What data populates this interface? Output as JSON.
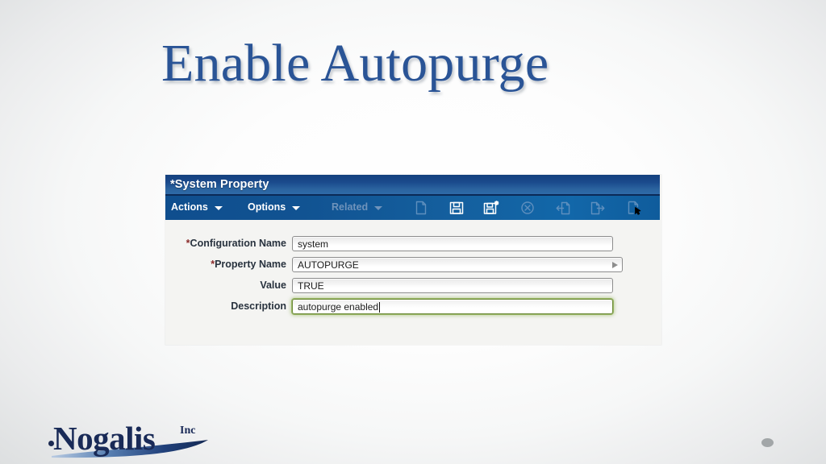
{
  "slide": {
    "title": "Enable Autopurge",
    "title_color": "#2a5496",
    "background_note": "white-center radial gradient to light gray edges"
  },
  "app_window": {
    "title": "*System Property",
    "titlebar_color": "#1a4a8c",
    "toolbar_color": "#115392",
    "menus": [
      {
        "label": "Actions",
        "caret": "chevron-down-icon",
        "enabled": true
      },
      {
        "label": "Options",
        "caret": "chevron-down-icon",
        "enabled": true
      },
      {
        "label": "Related",
        "caret": "chevron-down-icon",
        "enabled": false
      }
    ],
    "toolbar_icons": [
      {
        "name": "new-document-icon",
        "label": "New",
        "enabled": false
      },
      {
        "name": "save-icon",
        "label": "Save",
        "enabled": true
      },
      {
        "name": "save-as-icon",
        "label": "Save As",
        "enabled": true
      },
      {
        "name": "cancel-icon",
        "label": "Cancel",
        "enabled": false
      },
      {
        "name": "import-icon",
        "label": "Import",
        "enabled": false
      },
      {
        "name": "export-icon",
        "label": "Export",
        "enabled": false
      },
      {
        "name": "select-icon",
        "label": "Select",
        "enabled": false
      }
    ],
    "form": {
      "fields": [
        {
          "label": "Configuration Name",
          "required": true,
          "value": "system",
          "placeholder": "",
          "has_lov": false,
          "focused": false
        },
        {
          "label": "Property Name",
          "required": true,
          "value": "AUTOPURGE",
          "placeholder": "",
          "has_lov": true,
          "focused": false
        },
        {
          "label": "Value",
          "required": false,
          "value": "TRUE",
          "placeholder": "",
          "has_lov": false,
          "focused": false
        },
        {
          "label": "Description",
          "required": false,
          "value": "autopurge enabled",
          "placeholder": "",
          "has_lov": false,
          "focused": true,
          "focus_ring_color": "#97b563"
        }
      ]
    }
  },
  "branding": {
    "logo_word": "Nogalis",
    "logo_suffix": "Inc",
    "logo_color": "#192a57"
  }
}
